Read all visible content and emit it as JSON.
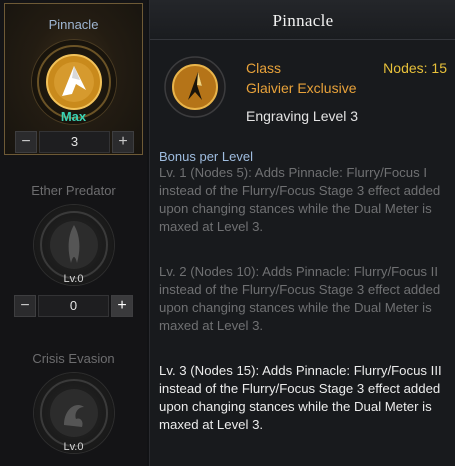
{
  "engravings": [
    {
      "name": "Pinnacle",
      "status": "Max",
      "value": "3",
      "minus": "−",
      "plus": "+"
    },
    {
      "name": "Ether Predator",
      "status": "Lv.0",
      "value": "0",
      "minus": "−",
      "plus": "+"
    },
    {
      "name": "Crisis Evasion",
      "status": "Lv.0"
    }
  ],
  "detail": {
    "title": "Pinnacle",
    "category": "Class",
    "nodes": "Nodes: 15",
    "class_name": "Glaivier Exclusive",
    "level": "Engraving Level 3",
    "bonus_heading": "Bonus per Level",
    "bonuses": [
      "Lv. 1 (Nodes 5): Adds Pinnacle: Flurry/Focus I instead of the Flurry/Focus Stage 3 effect added upon changing stances while the Dual Meter is maxed at Level 3.",
      "Lv. 2 (Nodes 10): Adds Pinnacle: Flurry/Focus II instead of the Flurry/Focus Stage 3 effect added upon changing stances while the Dual Meter is maxed at Level 3.",
      "Lv. 3 (Nodes 15): Adds Pinnacle: Flurry/Focus III instead of the Flurry/Focus Stage 3 effect added upon changing stances while the Dual Meter is maxed at Level 3."
    ]
  },
  "colors": {
    "accent_orange": "#e8a23a",
    "nodes_yellow": "#e8c13a",
    "max_teal": "#39d3b4",
    "heading_blue": "#9fbde0"
  },
  "icons": [
    "pinnacle-engraving-icon",
    "ether-predator-engraving-icon",
    "crisis-evasion-engraving-icon"
  ]
}
